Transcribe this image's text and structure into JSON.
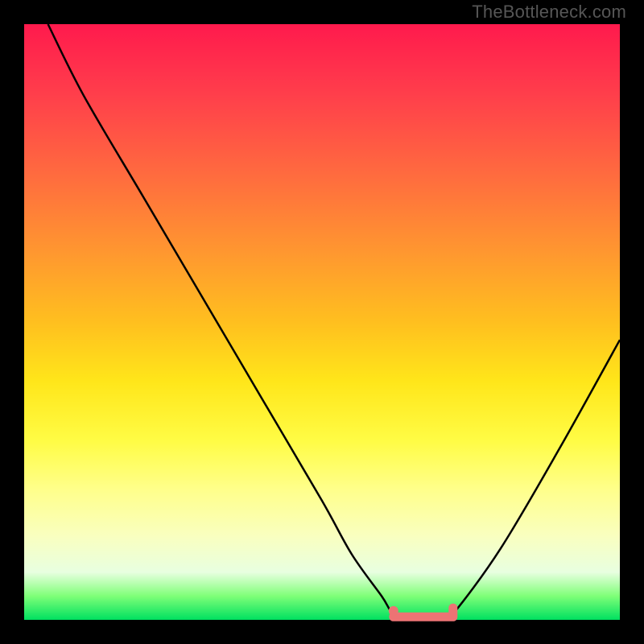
{
  "watermark": "TheBottleneck.com",
  "colors": {
    "background": "#000000",
    "curve": "#000000",
    "marker": "#ed7374",
    "gradient_top": "#ff1a4d",
    "gradient_bottom": "#00e060"
  },
  "chart_data": {
    "type": "line",
    "title": "",
    "xlabel": "",
    "ylabel": "",
    "xlim": [
      0,
      100
    ],
    "ylim": [
      0,
      100
    ],
    "series": [
      {
        "name": "bottleneck-curve",
        "x": [
          4,
          10,
          20,
          30,
          40,
          50,
          55,
          60,
          62,
          65,
          70,
          72,
          80,
          90,
          100
        ],
        "values": [
          100,
          88,
          71,
          54,
          37,
          20,
          11,
          4,
          1,
          0,
          0,
          1,
          12,
          29,
          47
        ]
      }
    ],
    "markers": [
      {
        "name": "flat-region",
        "x_start": 62,
        "x_end": 72,
        "y": 0.5,
        "y_end_knob": 2
      },
      {
        "name": "dot",
        "x": 62,
        "y": 1.5
      }
    ]
  }
}
